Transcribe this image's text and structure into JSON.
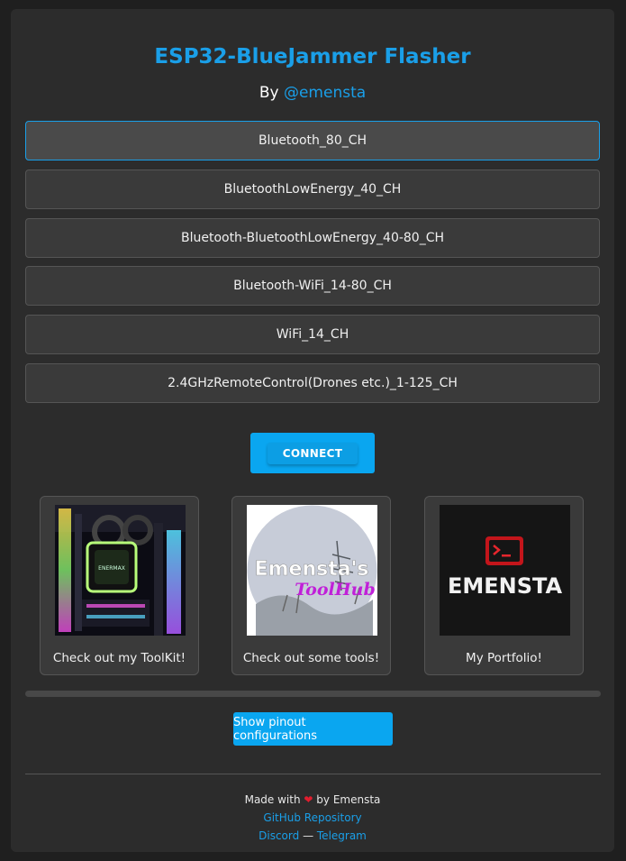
{
  "header": {
    "title": "ESP32-BlueJammer Flasher",
    "by_prefix": "By",
    "handle": "@emensta"
  },
  "options": [
    {
      "label": "Bluetooth_80_CH",
      "selected": true
    },
    {
      "label": "BluetoothLowEnergy_40_CH",
      "selected": false
    },
    {
      "label": "Bluetooth-BluetoothLowEnergy_40-80_CH",
      "selected": false
    },
    {
      "label": "Bluetooth-WiFi_14-80_CH",
      "selected": false
    },
    {
      "label": "WiFi_14_CH",
      "selected": false
    },
    {
      "label": "2.4GHzRemoteControl(Drones etc.)_1-125_CH",
      "selected": false
    }
  ],
  "connect_label": "CONNECT",
  "cards": [
    {
      "caption": "Check out my ToolKit!",
      "image": "pc-hardware-rgb-image"
    },
    {
      "caption": "Check out some tools!",
      "image": "emenstas-toolhub-logo",
      "logo_text_1": "Emensta's",
      "logo_text_2": "ToolHub"
    },
    {
      "caption": "My Portfolio!",
      "image": "emensta-terminal-logo",
      "logo_text": "EMENSTA"
    }
  ],
  "pinout_button": "Show pinout configurations",
  "footer": {
    "made_with": "Made with",
    "heart_icon": "heart-icon",
    "by_author": "by Emensta",
    "github": "GitHub Repository",
    "discord": "Discord",
    "separator": "—",
    "telegram": "Telegram"
  },
  "colors": {
    "accent": "#1a9fe8",
    "button": "#0aa6f0",
    "panel": "#2c2c2c",
    "background": "#1f1f1f",
    "heart": "#e11d2e"
  }
}
